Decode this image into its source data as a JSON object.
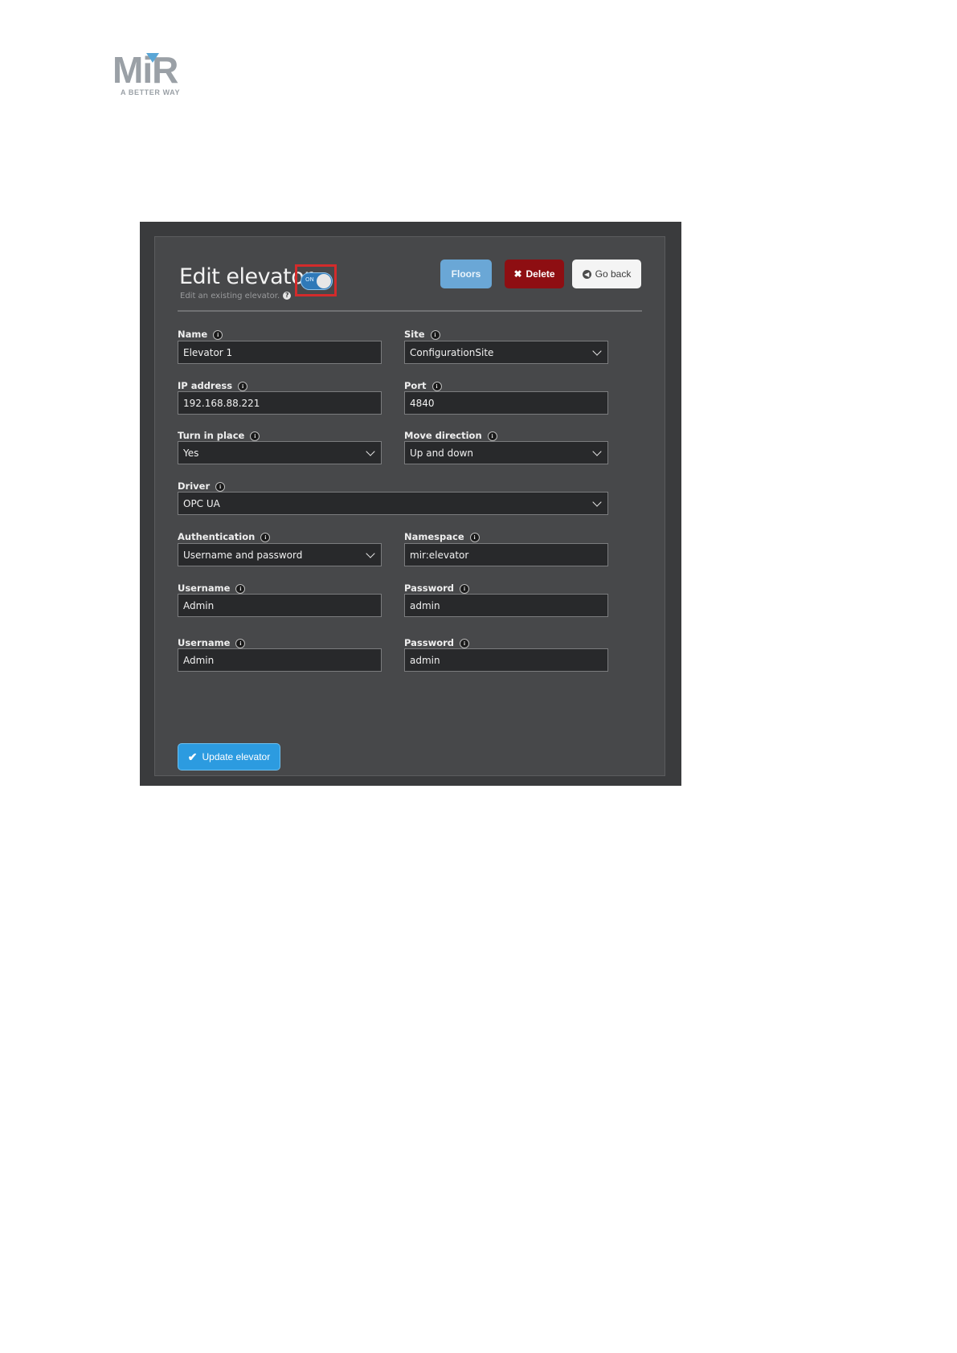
{
  "logo": {
    "wordmark": "MiR",
    "tagline": "A BETTER WAY"
  },
  "header": {
    "title": "Edit elevator",
    "subtitle": "Edit an existing elevator.",
    "toggle_label": "ON",
    "toggle_state": "on"
  },
  "buttons": {
    "floors": "Floors",
    "delete": "Delete",
    "go_back": "Go back",
    "update": "Update elevator"
  },
  "fields": {
    "name": {
      "label": "Name",
      "value": "Elevator 1"
    },
    "site": {
      "label": "Site",
      "value": "ConfigurationSite"
    },
    "ip_address": {
      "label": "IP address",
      "value": "192.168.88.221"
    },
    "port": {
      "label": "Port",
      "value": "4840"
    },
    "turn_in_place": {
      "label": "Turn in place",
      "value": "Yes"
    },
    "move_direction": {
      "label": "Move direction",
      "value": "Up and down"
    },
    "driver": {
      "label": "Driver",
      "value": "OPC UA"
    },
    "authentication": {
      "label": "Authentication",
      "value": "Username and password"
    },
    "namespace": {
      "label": "Namespace",
      "value": "mir:elevator"
    },
    "username_1": {
      "label": "Username",
      "value": "Admin"
    },
    "password_1": {
      "label": "Password",
      "value": "admin"
    },
    "username_2": {
      "label": "Username",
      "value": "Admin"
    },
    "password_2": {
      "label": "Password",
      "value": "admin"
    }
  },
  "colors": {
    "primary": "#2c9be0",
    "danger": "#8e0e12",
    "floors": "#6aa7d6",
    "highlight": "#d32b2b",
    "panel": "#47484a"
  }
}
